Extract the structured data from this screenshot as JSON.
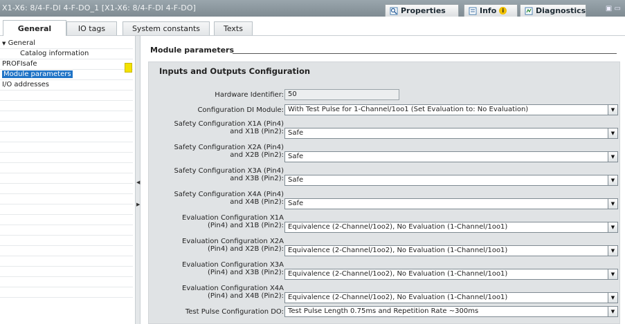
{
  "window": {
    "title": "X1-X6: 8/4-F-DI 4-F-DO_1 [X1-X6: 8/4-F-DI 4-F-DO]",
    "tabs": [
      {
        "label": "Properties",
        "icon": "properties-icon"
      },
      {
        "label": "Info",
        "icon": "info-icon",
        "badge": "i"
      },
      {
        "label": "Diagnostics",
        "icon": "diagnostics-icon"
      }
    ]
  },
  "inspector_tabs": [
    "General",
    "IO tags",
    "System constants",
    "Texts"
  ],
  "nav": {
    "items": [
      {
        "label": "General",
        "expander": "▼",
        "indent": 0
      },
      {
        "label": "Catalog information",
        "indent": 1
      },
      {
        "label": "PROFIsafe",
        "indent": 0
      },
      {
        "label": "Module parameters",
        "indent": 0,
        "selected": true
      },
      {
        "label": "I/O addresses",
        "indent": 0
      }
    ]
  },
  "content": {
    "section_title": "Module parameters",
    "group_title": "Inputs and Outputs Configuration",
    "fields": [
      {
        "label1": "Hardware Identifier:",
        "label2": "",
        "value": "50",
        "type": "readonly"
      },
      {
        "label1": "Configuration DI Module:",
        "label2": "",
        "value": "With Test Pulse for 1-Channel/1oo1 (Set Evaluation to: No Evaluation)",
        "type": "dropdown"
      },
      {
        "label1": "Safety Configuration X1A (Pin4)",
        "label2": "and X1B (Pin2):",
        "value": "Safe",
        "type": "dropdown"
      },
      {
        "label1": "Safety Configuration X2A (Pin4)",
        "label2": "and X2B (Pin2):",
        "value": "Safe",
        "type": "dropdown"
      },
      {
        "label1": "Safety Configuration X3A (Pin4)",
        "label2": "and X3B (Pin2):",
        "value": "Safe",
        "type": "dropdown"
      },
      {
        "label1": "Safety Configuration X4A (Pin4)",
        "label2": "and X4B (Pin2):",
        "value": "Safe",
        "type": "dropdown"
      },
      {
        "label1": "Evaluation Configuration X1A",
        "label2": "(Pin4) and X1B (Pin2):",
        "value": "Equivalence (2-Channel/1oo2), No Evaluation (1-Channel/1oo1)",
        "type": "dropdown"
      },
      {
        "label1": "Evaluation Configuration X2A",
        "label2": "(Pin4) and X2B (Pin2):",
        "value": "Equivalence (2-Channel/1oo2), No Evaluation (1-Channel/1oo1)",
        "type": "dropdown"
      },
      {
        "label1": "Evaluation Configuration X3A",
        "label2": "(Pin4) and X3B (Pin2):",
        "value": "Equivalence (2-Channel/1oo2), No Evaluation (1-Channel/1oo1)",
        "type": "dropdown"
      },
      {
        "label1": "Evaluation Configuration X4A",
        "label2": "(Pin4) and X4B (Pin2):",
        "value": "Equivalence (2-Channel/1oo2), No Evaluation (1-Channel/1oo1)",
        "type": "dropdown"
      },
      {
        "label1": "Test Pulse Configuration DO:",
        "label2": "",
        "value": "Test Pulse Length 0.75ms and Repetition Rate ~300ms",
        "type": "dropdown"
      }
    ]
  },
  "colors": {
    "selection": "#1f73c6",
    "warning_marker": "#f3e200",
    "titlebar": "#8a969d"
  }
}
